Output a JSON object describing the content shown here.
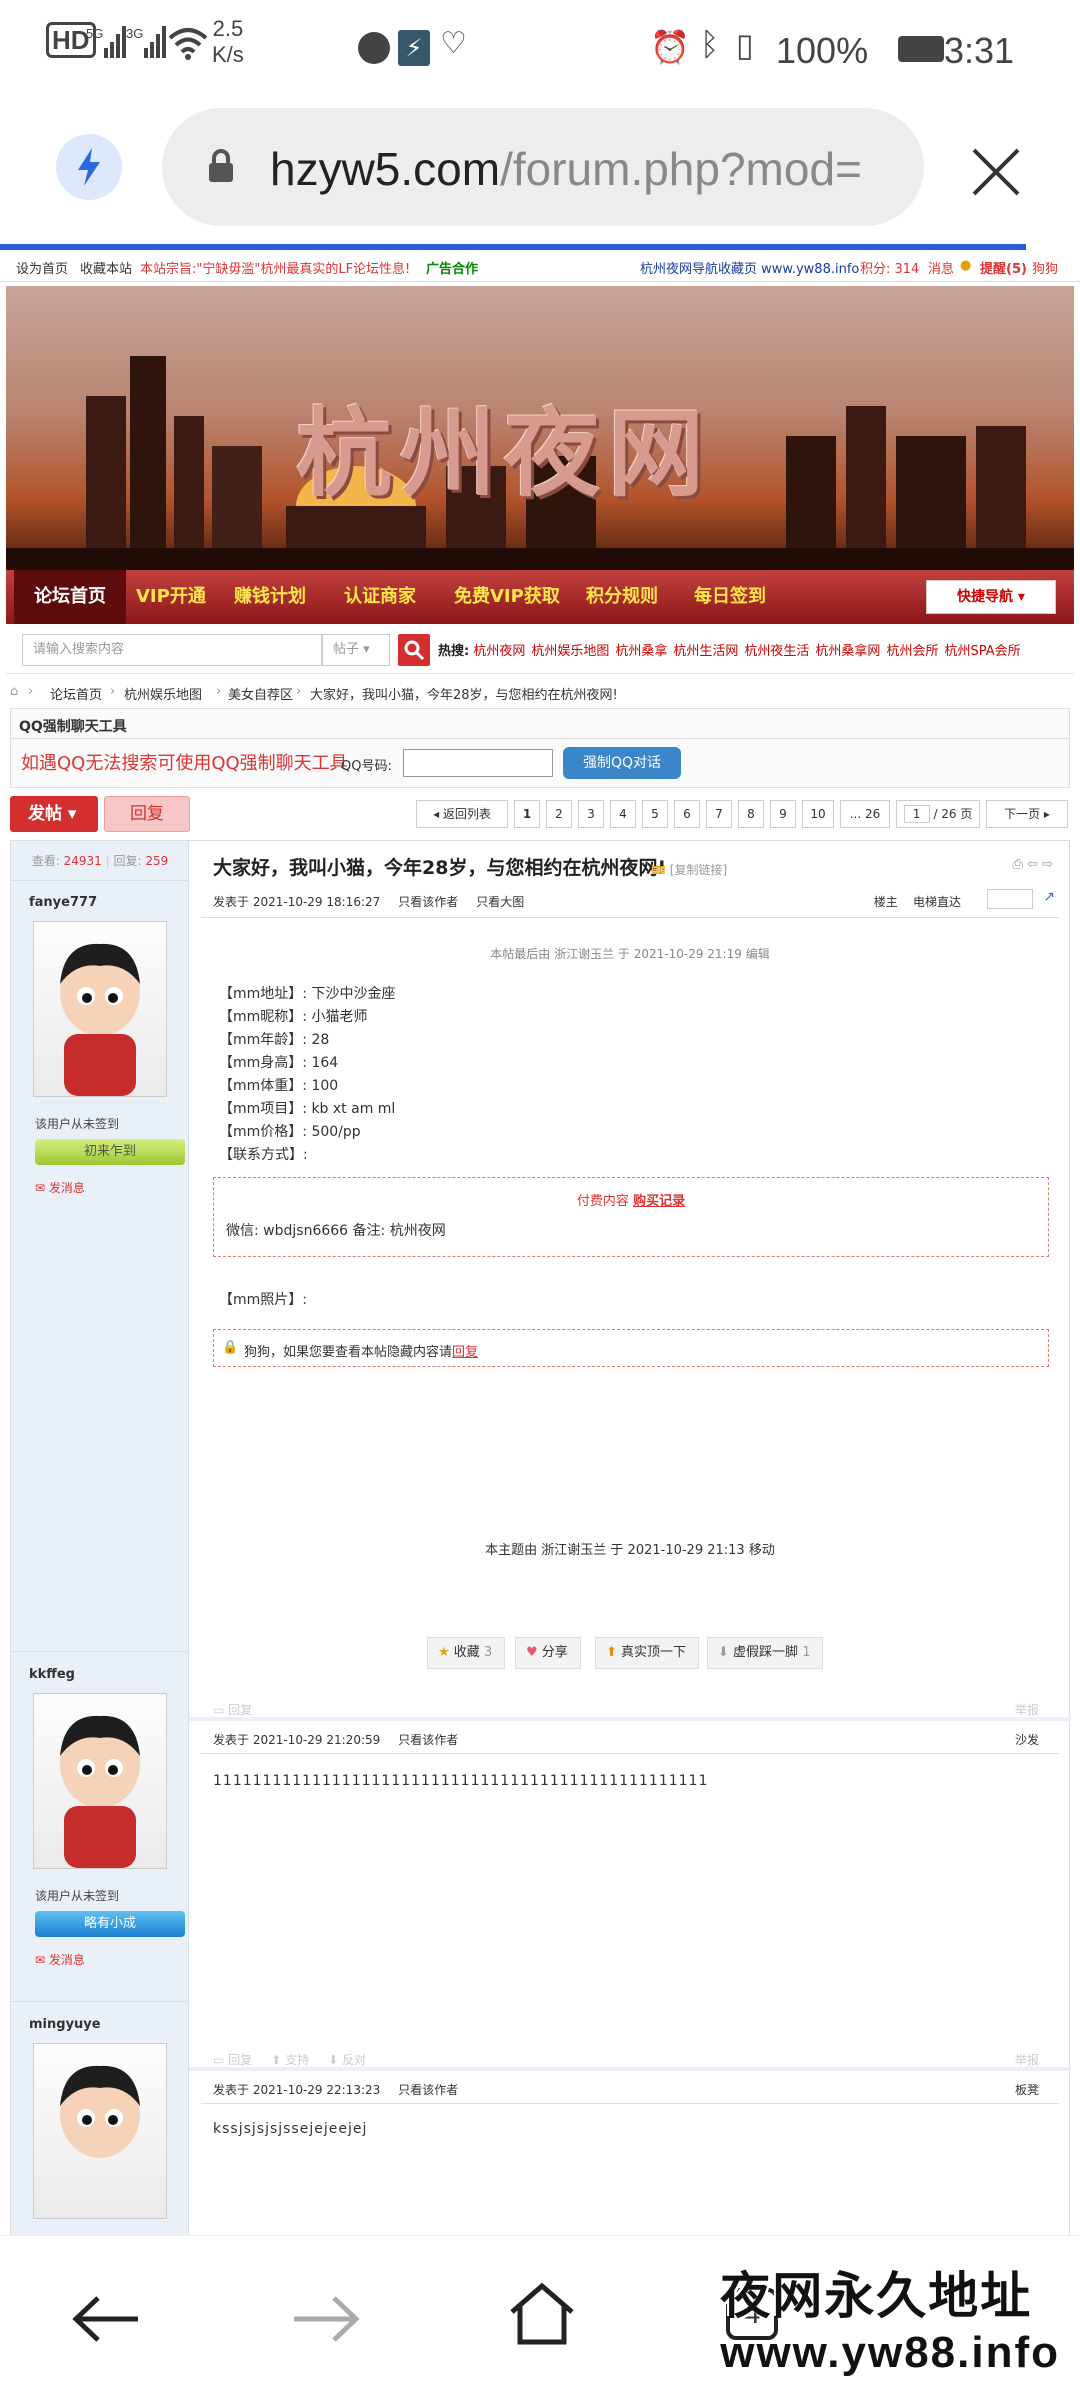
{
  "status_bar": {
    "net_speed_value": "2.5",
    "net_speed_unit": "K/s",
    "battery": "100%",
    "time": "3:31"
  },
  "browser": {
    "url_host": "hzyw5.com",
    "url_path": "/forum.php?mod="
  },
  "top_links": {
    "home": "设为首页",
    "bookmark": "收藏本站",
    "notice": "本站宗旨:\"宁缺毋滥\"杭州最真实的LF论坛性息!",
    "ad": "广告合作",
    "nav_site": "杭州夜网导航收藏页 www.yw88.info",
    "points": "积分: 314",
    "messages": "消息",
    "reminders": "提醒(5)",
    "user": "狗狗"
  },
  "banner": {
    "title": "杭州夜网"
  },
  "nav": {
    "items": [
      "论坛首页",
      "VIP开通",
      "赚钱计划",
      "认证商家",
      "免费VIP获取",
      "积分规则",
      "每日签到"
    ],
    "quick": "快捷导航"
  },
  "search": {
    "placeholder": "请输入搜索内容",
    "type": "帖子",
    "hot_label": "热搜:",
    "hot": [
      "杭州夜网",
      "杭州娱乐地图",
      "杭州桑拿",
      "杭州生活网",
      "杭州夜生活",
      "杭州桑拿网",
      "杭州会所",
      "杭州SPA会所"
    ]
  },
  "breadcrumb": [
    "论坛首页",
    "杭州娱乐地图",
    "美女自荐区",
    "大家好，我叫小猫，今年28岁，与您相约在杭州夜网!"
  ],
  "qq_tool": {
    "title": "QQ强制聊天工具",
    "desc": "如遇QQ无法搜索可使用QQ强制聊天工具",
    "label": "QQ号码:",
    "button": "强制QQ对话"
  },
  "actions": {
    "post": "发帖",
    "reply": "回复"
  },
  "pager": {
    "back": "返回列表",
    "pages": [
      "1",
      "2",
      "3",
      "4",
      "5",
      "6",
      "7",
      "8",
      "9",
      "10",
      "... 26"
    ],
    "input": "1",
    "total": "/ 26 页",
    "next": "下一页"
  },
  "thread": {
    "views_label": "查看:",
    "views": "24931",
    "replies_label": "回复:",
    "replies": "259",
    "title": "大家好，我叫小猫，今年28岁，与您相约在杭州夜网!",
    "copy_link": "[复制链接]"
  },
  "posts": [
    {
      "author": "fanye777",
      "sign": "该用户从未签到",
      "medal": "初来乍到",
      "send_msg": "发消息",
      "time": "发表于 2021-10-29 18:16:27",
      "only_author": "只看该作者",
      "big_image": "只看大图",
      "floor": "楼主",
      "elevator": "电梯直达",
      "edit_note": "本帖最后由 浙江谢玉兰 于 2021-10-29 21:19 编辑",
      "fields": [
        "【mm地址】: 下沙中沙金座",
        "【mm昵称】: 小猫老师",
        "【mm年龄】: 28",
        "【mm身高】: 164",
        "【mm体重】: 100",
        "【mm项目】: kb xt am ml",
        "【mm价格】: 500/pp",
        "【联系方式】:"
      ],
      "paid_label": "付费内容",
      "paid_link": "购买记录",
      "paid_text": "微信: wbdjsn6666  备注: 杭州夜网",
      "photos_label": "【mm照片】:",
      "hidden_text": "狗狗，如果您要查看本帖隐藏内容请",
      "hidden_link": "回复",
      "moved_note": "本主题由 浙江谢玉兰 于 2021-10-29 21:13 移动",
      "buttons": [
        {
          "label": "收藏",
          "count": "3"
        },
        {
          "label": "分享",
          "count": ""
        },
        {
          "label": "真实顶一下",
          "count": ""
        },
        {
          "label": "虚假踩一脚",
          "count": "1"
        }
      ],
      "foot_reply": "回复",
      "foot_report": "举报"
    },
    {
      "author": "kkffeg",
      "sign": "该用户从未签到",
      "medal": "略有小成",
      "send_msg": "发消息",
      "time": "发表于 2021-10-29 21:20:59",
      "only_author": "只看该作者",
      "floor": "沙发",
      "body": "11111111111111111111111111111111111111111111111111",
      "foot_reply": "回复",
      "foot_support": "支持",
      "foot_oppose": "反对",
      "foot_report": "举报"
    },
    {
      "author": "mingyuye",
      "time": "发表于 2021-10-29 22:13:23",
      "only_author": "只看该作者",
      "floor": "板凳",
      "body": "kssjsjsjsjssejejeejej"
    }
  ],
  "watermark": {
    "line1": "夜网永久地址",
    "line2": "www.yw88.info"
  },
  "bottom_nav": {
    "tabs": "4"
  },
  "colors": {
    "accent": "#d32f2f",
    "nav_text": "#ffe64a",
    "link_red": "#cc0000",
    "progress": "#2a5bd7"
  }
}
